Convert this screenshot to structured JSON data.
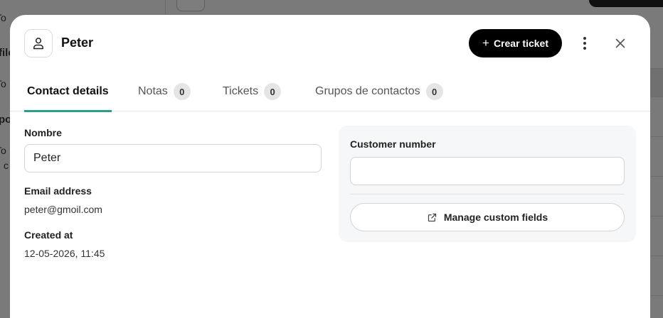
{
  "background": {
    "fragments": [
      "To",
      "file",
      "To",
      "po",
      "To",
      "c"
    ]
  },
  "modal": {
    "contact_name": "Peter",
    "create_ticket_label": "Crear ticket",
    "tabs": [
      {
        "label": "Contact details",
        "count": null
      },
      {
        "label": "Notas",
        "count": "0"
      },
      {
        "label": "Tickets",
        "count": "0"
      },
      {
        "label": "Grupos de contactos",
        "count": "0"
      }
    ],
    "fields": {
      "name_label": "Nombre",
      "name_value": "Peter",
      "email_label": "Email address",
      "email_value": "peter@gmoil.com",
      "created_label": "Created at",
      "created_value": "12-05-2026, 11:45"
    },
    "custom": {
      "customer_number_label": "Customer number",
      "customer_number_value": "",
      "manage_label": "Manage custom fields"
    }
  },
  "colors": {
    "accent": "#2a9d8f",
    "primary_button": "#000000",
    "overlay": "#7a7a7a"
  },
  "icons": [
    "user-icon",
    "plus-icon",
    "more-vertical-icon",
    "close-icon",
    "external-link-icon"
  ]
}
